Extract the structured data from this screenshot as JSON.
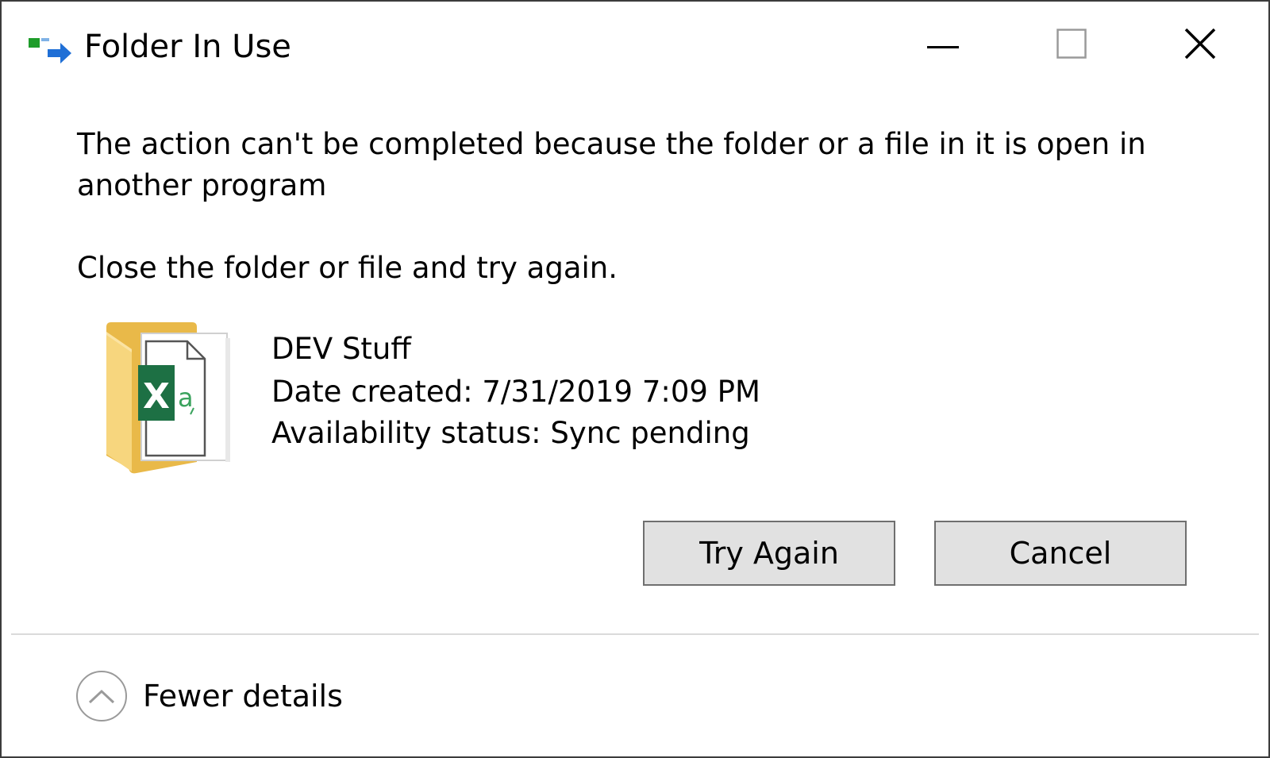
{
  "window": {
    "title": "Folder In Use",
    "icons": {
      "app": "folder-move-icon",
      "minimize": "minimize-icon",
      "maximize": "maximize-icon",
      "close": "close-icon"
    }
  },
  "message": {
    "line1": "The action can't be completed because the folder or a file in it is open in",
    "line2": "another program",
    "instruction": "Close the folder or file and try again."
  },
  "file": {
    "icon": "excel-folder-icon",
    "name": "DEV Stuff",
    "date_created": "Date created: 7/31/2019 7:09 PM",
    "availability": "Availability status: Sync pending"
  },
  "buttons": {
    "try_again": "Try Again",
    "cancel": "Cancel"
  },
  "details": {
    "toggle_label": "Fewer details",
    "icon": "chevron-up-icon"
  },
  "colors": {
    "button_face": "#e1e1e1",
    "button_border": "#6f6f6f",
    "excel_green": "#1d7044",
    "folder_yellow": "#f5d27a"
  }
}
